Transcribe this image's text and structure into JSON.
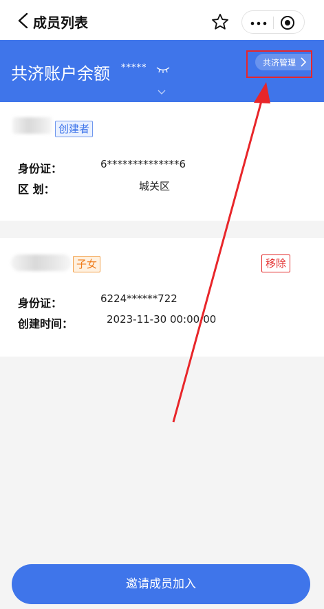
{
  "nav": {
    "title": "成员列表"
  },
  "banner": {
    "title": "共济账户余额",
    "masked_balance": "*****",
    "manage_label": "共济管理"
  },
  "members": [
    {
      "role_tag": "创建者",
      "fields": [
        {
          "label": "身份证：",
          "value": "6**************6"
        },
        {
          "label": "区 划：",
          "value": "城关区"
        }
      ]
    },
    {
      "role_tag": "子女",
      "remove_label": "移除",
      "fields": [
        {
          "label": "身份证：",
          "value": "6224******722"
        },
        {
          "label": "创建时间：",
          "value": "2023-11-30 00:00:00"
        }
      ]
    }
  ],
  "footer": {
    "invite_label": "邀请成员加入"
  },
  "colors": {
    "primary": "#3f75ea",
    "annotation": "#e8262a"
  }
}
